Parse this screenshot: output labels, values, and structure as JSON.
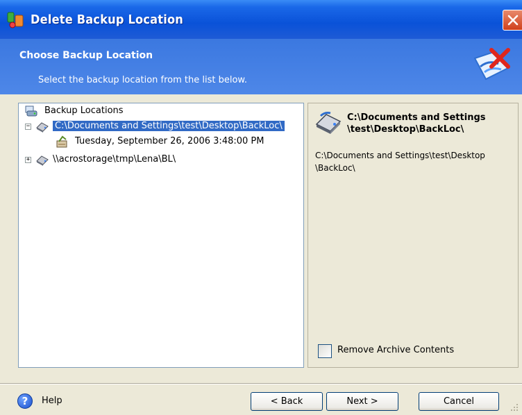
{
  "window": {
    "title": "Delete Backup Location",
    "icons": {
      "app": "acronis-app-icon",
      "close": "close-icon"
    }
  },
  "header": {
    "title": "Choose Backup Location",
    "subtitle": "Select the backup location from the list below.",
    "icon": "delete-backup-wizard-icon"
  },
  "tree": {
    "root": {
      "label": "Backup Locations",
      "icon": "backup-locations-icon"
    },
    "items": [
      {
        "label": "C:\\Documents and Settings\\test\\Desktop\\BackLoc\\",
        "expander": "−",
        "expanded": true,
        "selected": true,
        "icon": "drive-icon",
        "children": [
          {
            "label": "Tuesday, September 26, 2006 3:48:00 PM",
            "icon": "archive-icon"
          }
        ]
      },
      {
        "label": "\\\\acrostorage\\tmp\\Lena\\BL\\",
        "expander": "+",
        "expanded": false,
        "selected": false,
        "icon": "drive-icon"
      }
    ]
  },
  "detail": {
    "heading_line1": "C:\\Documents and Settings",
    "heading_line2": "\\test\\Desktop\\BackLoc\\",
    "path_line1": "C:\\Documents and Settings\\test\\Desktop",
    "path_line2": "\\BackLoc\\",
    "remove_label": "Remove Archive Contents",
    "remove_checked": false
  },
  "footer": {
    "help_label": "Help",
    "back_label": "< Back",
    "next_label": "Next >",
    "cancel_label": "Cancel"
  },
  "colors": {
    "titlebar": "#0a52d8",
    "header": "#4e87e8",
    "selection": "#316ac5",
    "face": "#ece9d8"
  }
}
